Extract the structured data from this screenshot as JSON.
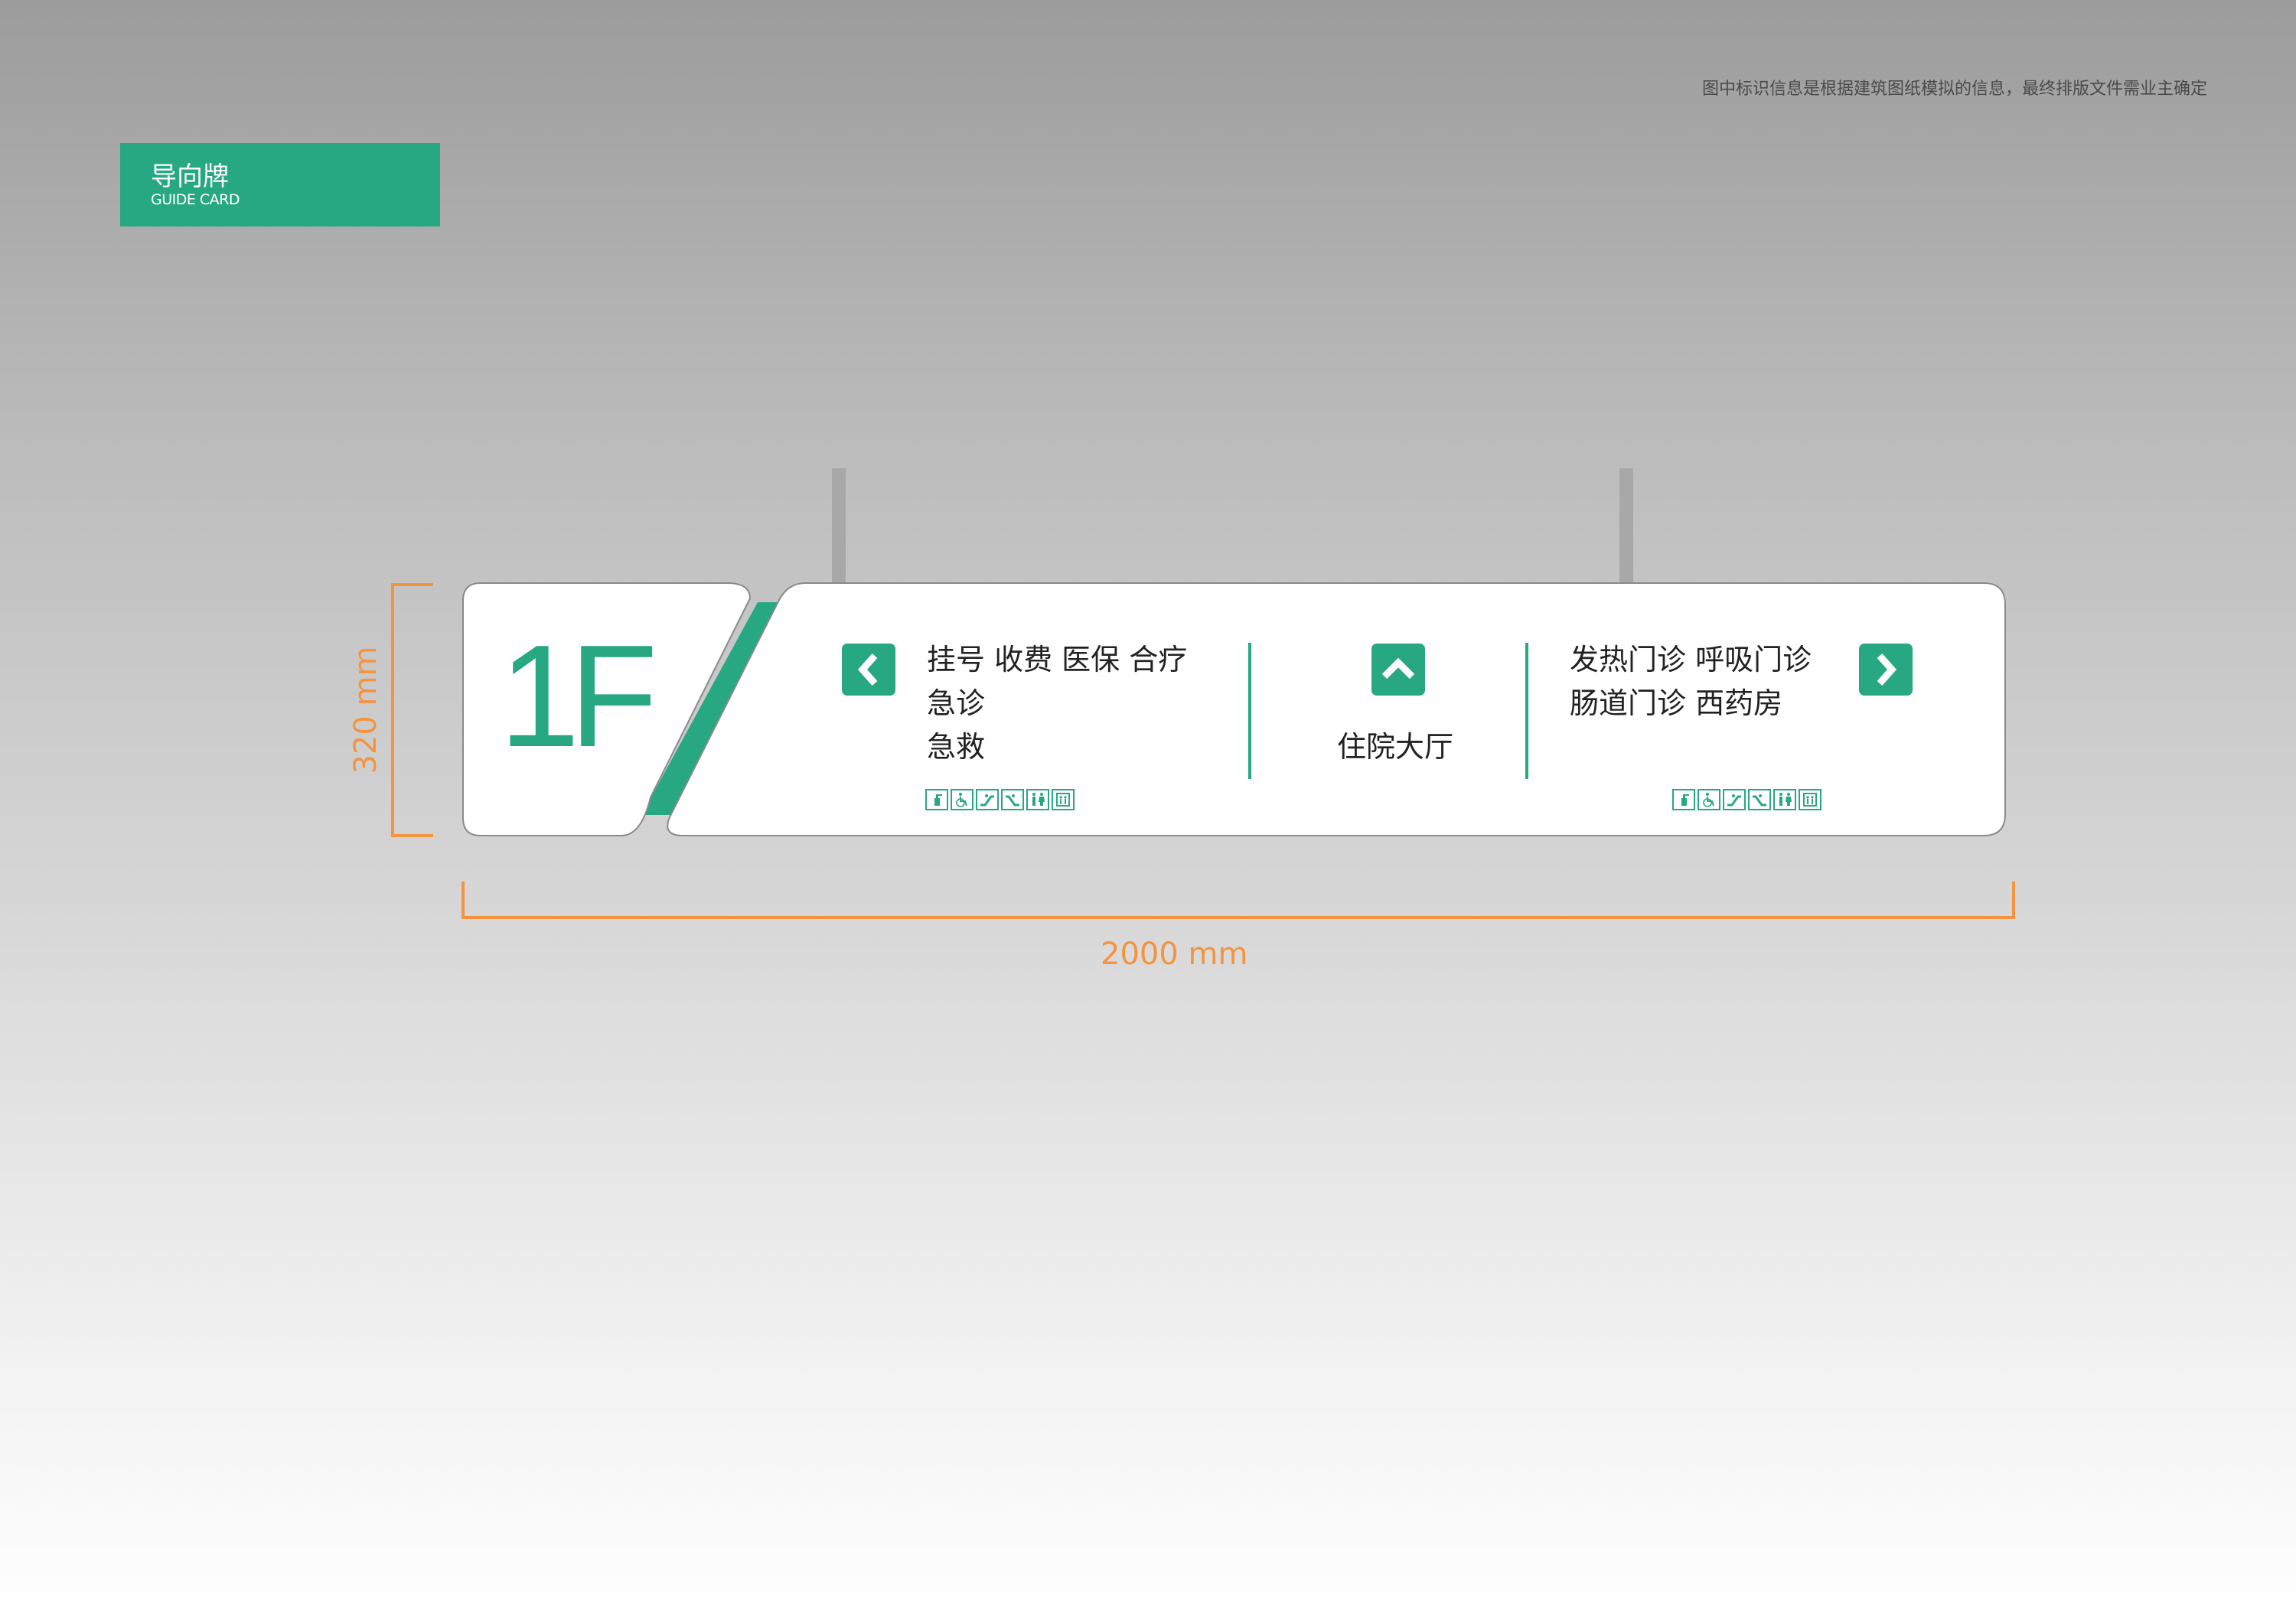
{
  "note": "图中标识信息是根据建筑图纸模拟的信息，最终排版文件需业主确定",
  "badge": {
    "title": "导向牌",
    "subtitle": "GUIDE CARD"
  },
  "sign": {
    "floor": "1F",
    "left": {
      "lines": [
        "挂号  收费  医保  合疗",
        "急诊",
        "急救"
      ]
    },
    "center": {
      "label": "住院大厅"
    },
    "right": {
      "lines": [
        "发热门诊  呼吸门诊",
        "肠道门诊  西药房"
      ]
    },
    "facility_icons": [
      "hand-sanitizer-icon",
      "wheelchair-icon",
      "escalator-up-icon",
      "escalator-down-icon",
      "restroom-icon",
      "elevator-icon"
    ],
    "arrow_icons": {
      "left": "arrow-left-icon",
      "center": "arrow-up-icon",
      "right": "arrow-right-icon"
    }
  },
  "dimensions": {
    "width_label": "2000 mm",
    "height_label": "320 mm"
  },
  "colors": {
    "brand_green": "#27a882",
    "dimension_orange": "#f5943f"
  }
}
